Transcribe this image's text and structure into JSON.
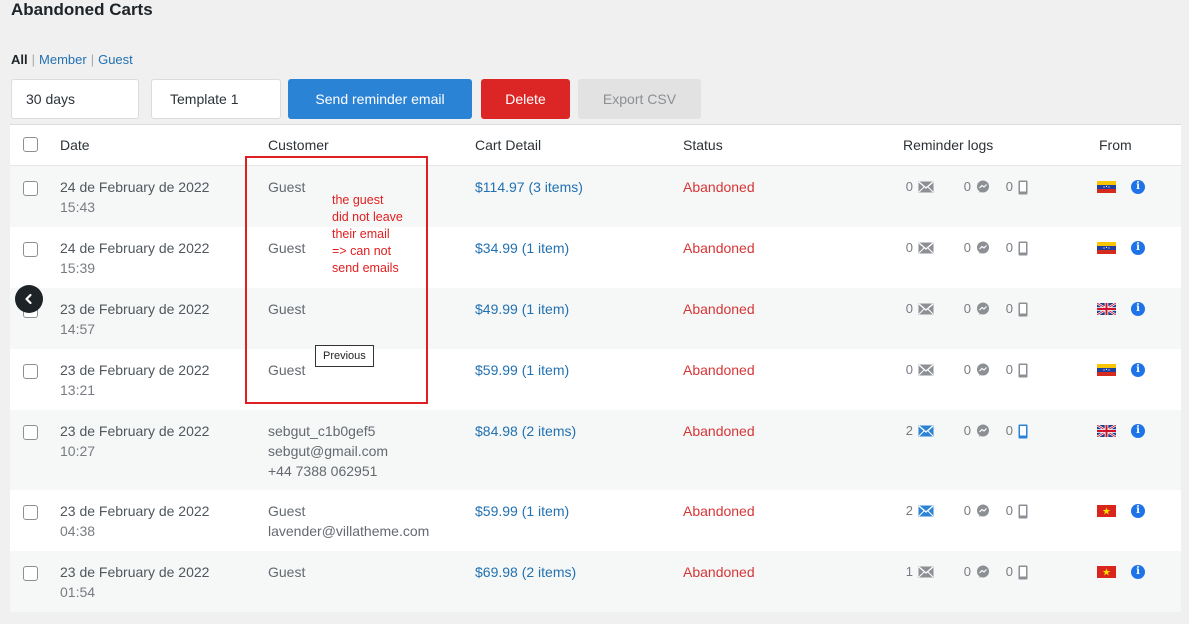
{
  "page": {
    "title": "Abandoned Carts"
  },
  "filters": {
    "all": "All",
    "member": "Member",
    "guest": "Guest"
  },
  "controls": {
    "period": "30 days",
    "template": "Template 1",
    "send_label": "Send reminder email",
    "delete_label": "Delete",
    "export_label": "Export CSV"
  },
  "columns": {
    "date": "Date",
    "customer": "Customer",
    "cart": "Cart Detail",
    "status": "Status",
    "logs": "Reminder logs",
    "from": "From"
  },
  "rows": [
    {
      "date": "24 de February de 2022",
      "time": "15:43",
      "customer": [
        "Guest"
      ],
      "cart": "$114.97 (3 items)",
      "status": "Abandoned",
      "email_count": "0",
      "msg_count": "0",
      "sms_count": "0",
      "email_active": false,
      "sms_active": false,
      "flag": "venezuela-flag-icon"
    },
    {
      "date": "24 de February de 2022",
      "time": "15:39",
      "customer": [
        "Guest"
      ],
      "cart": "$34.99 (1 item)",
      "status": "Abandoned",
      "email_count": "0",
      "msg_count": "0",
      "sms_count": "0",
      "email_active": false,
      "sms_active": false,
      "flag": "venezuela-flag-icon"
    },
    {
      "date": "23 de February de 2022",
      "time": "14:57",
      "customer": [
        "Guest"
      ],
      "cart": "$49.99 (1 item)",
      "status": "Abandoned",
      "email_count": "0",
      "msg_count": "0",
      "sms_count": "0",
      "email_active": false,
      "sms_active": false,
      "flag": "uk-flag-icon"
    },
    {
      "date": "23 de February de 2022",
      "time": "13:21",
      "customer": [
        "Guest"
      ],
      "cart": "$59.99 (1 item)",
      "status": "Abandoned",
      "email_count": "0",
      "msg_count": "0",
      "sms_count": "0",
      "email_active": false,
      "sms_active": false,
      "flag": "venezuela-flag-icon"
    },
    {
      "date": "23 de February de 2022",
      "time": "10:27",
      "customer": [
        "sebgut_c1b0gef5",
        "sebgut@gmail.com",
        "+44 7388 062951"
      ],
      "cart": "$84.98 (2 items)",
      "status": "Abandoned",
      "email_count": "2",
      "msg_count": "0",
      "sms_count": "0",
      "email_active": true,
      "sms_active": true,
      "flag": "uk-flag-icon"
    },
    {
      "date": "23 de February de 2022",
      "time": "04:38",
      "customer": [
        "Guest",
        "lavender@villatheme.com"
      ],
      "cart": "$59.99 (1 item)",
      "status": "Abandoned",
      "email_count": "2",
      "msg_count": "0",
      "sms_count": "0",
      "email_active": true,
      "sms_active": false,
      "flag": "vietnam-flag-icon"
    },
    {
      "date": "23 de February de 2022",
      "time": "01:54",
      "customer": [
        "Guest"
      ],
      "cart": "$69.98 (2 items)",
      "status": "Abandoned",
      "email_count": "1",
      "msg_count": "0",
      "sms_count": "0",
      "email_active": false,
      "sms_active": false,
      "flag": "vietnam-flag-icon"
    }
  ],
  "annotation": {
    "lines": [
      "the guest",
      "did not leave",
      "their email",
      "=> can not",
      "send emails"
    ]
  },
  "tooltip": {
    "text": "Previous"
  },
  "colors": {
    "accent": "#2b83d6",
    "danger": "#dc2626",
    "status": "#d63638",
    "link": "#2271b1"
  }
}
